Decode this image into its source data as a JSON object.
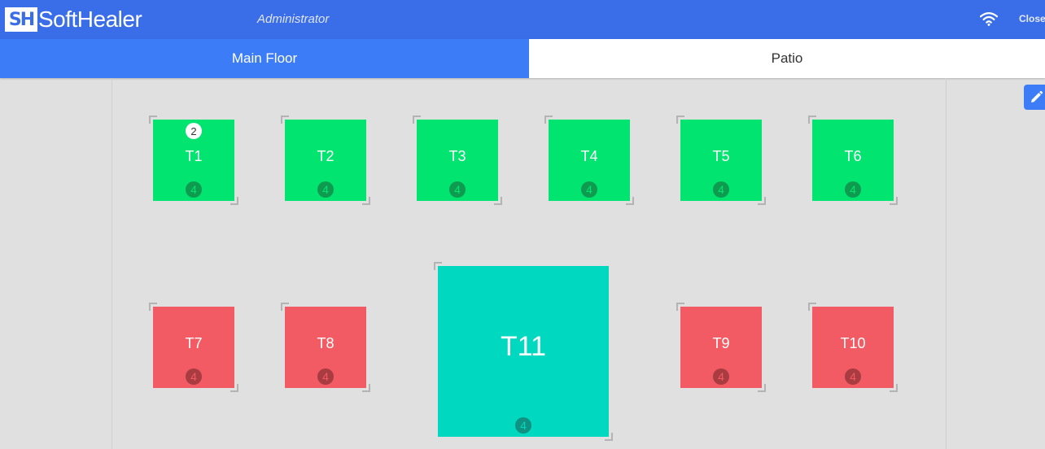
{
  "header": {
    "logo_mark": "SH",
    "logo_text": "SoftHealer",
    "role": "Administrator",
    "close_label": "Close",
    "wifi_icon": "wifi-icon"
  },
  "tabs": [
    {
      "label": "Main Floor",
      "active": true
    },
    {
      "label": "Patio",
      "active": false
    }
  ],
  "edit_icon": "pencil-icon",
  "colors": {
    "available": "#01e46f",
    "available_badge": "#0f9b4f",
    "occupied": "#f25b63",
    "occupied_badge": "#a83c41",
    "highlight": "#00d9c0",
    "highlight_badge": "#0f9282"
  },
  "tables": [
    {
      "name": "T1",
      "seats": "4",
      "guests": "2",
      "status": "available"
    },
    {
      "name": "T2",
      "seats": "4",
      "status": "available"
    },
    {
      "name": "T3",
      "seats": "4",
      "status": "available"
    },
    {
      "name": "T4",
      "seats": "4",
      "status": "available"
    },
    {
      "name": "T5",
      "seats": "4",
      "status": "available"
    },
    {
      "name": "T6",
      "seats": "4",
      "status": "available"
    },
    {
      "name": "T7",
      "seats": "4",
      "status": "occupied"
    },
    {
      "name": "T8",
      "seats": "4",
      "status": "occupied"
    },
    {
      "name": "T11",
      "seats": "4",
      "status": "highlight"
    },
    {
      "name": "T9",
      "seats": "4",
      "status": "occupied"
    },
    {
      "name": "T10",
      "seats": "4",
      "status": "occupied"
    }
  ]
}
